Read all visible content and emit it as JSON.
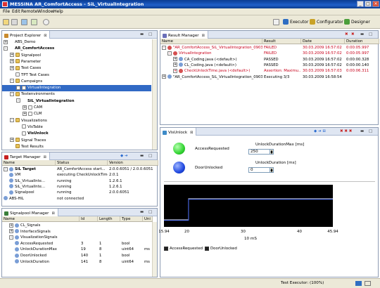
{
  "window": {
    "title": "MESSINA   AR_ComfortAccess - SiL_VirtualIntegration",
    "controls": [
      "_",
      "□",
      "×"
    ]
  },
  "menu": [
    "File",
    "Edit",
    "Remote",
    "Window",
    "Help"
  ],
  "perspectives": [
    {
      "label": "Executor",
      "icon": "executor-icon"
    },
    {
      "label": "Configurator",
      "icon": "configurator-icon"
    },
    {
      "label": "Designer",
      "icon": "designer-icon"
    }
  ],
  "project_explorer": {
    "title": "Project Explorer",
    "items": [
      {
        "label": "ABS_Demo",
        "indent": 0,
        "icon": "project",
        "exp": "+"
      },
      {
        "label": "AR_ComfortAccess",
        "indent": 0,
        "icon": "project",
        "exp": "-",
        "bold": true
      },
      {
        "label": "Signalpool",
        "indent": 1,
        "icon": "folder",
        "exp": "+"
      },
      {
        "label": "Parameter",
        "indent": 1,
        "icon": "folder",
        "exp": "+"
      },
      {
        "label": "Test Cases",
        "indent": 1,
        "icon": "folder",
        "exp": "+"
      },
      {
        "label": "TPT Test Cases",
        "indent": 1,
        "icon": "file",
        "exp": ""
      },
      {
        "label": "Campaigns",
        "indent": 1,
        "icon": "folder",
        "exp": "-"
      },
      {
        "label": "VirtualIntegration",
        "indent": 2,
        "icon": "file",
        "exp": "+",
        "selected": true
      },
      {
        "label": "Testenvironments",
        "indent": 1,
        "icon": "folder",
        "exp": "-"
      },
      {
        "label": "SiL_VirtualIntegration",
        "indent": 2,
        "icon": "project",
        "exp": "-",
        "bold": true
      },
      {
        "label": "CAM",
        "indent": 3,
        "icon": "file",
        "exp": "+"
      },
      {
        "label": "CLM",
        "indent": 3,
        "icon": "file",
        "exp": "+"
      },
      {
        "label": "Visualizations",
        "indent": 1,
        "icon": "folder",
        "exp": "-"
      },
      {
        "label": "VisTable",
        "indent": 2,
        "icon": "file",
        "exp": ""
      },
      {
        "label": "VisUnlock",
        "indent": 2,
        "icon": "file",
        "exp": "",
        "bold": true
      },
      {
        "label": "Signal Traces",
        "indent": 1,
        "icon": "folder",
        "exp": "+"
      },
      {
        "label": "Test Results",
        "indent": 1,
        "icon": "folder",
        "exp": ""
      }
    ]
  },
  "target_manager": {
    "title": "Target Manager",
    "columns": [
      "Name",
      "Status",
      "Version"
    ],
    "rows": [
      {
        "name": "SiL Target",
        "status": "AR_ComfortAccess start...",
        "version": "2.0.0.6051 / 2.0.0.6051",
        "indent": 0,
        "exp": "-",
        "bold": true
      },
      {
        "name": "VM",
        "status": "executing CheckUnlockTime",
        "version": "2.0.1",
        "indent": 1,
        "exp": ""
      },
      {
        "name": "SiL_VirtualInte...",
        "status": "running",
        "version": "1.2.6.1",
        "indent": 1,
        "exp": ""
      },
      {
        "name": "SiL_VirtualInte...",
        "status": "running",
        "version": "1.2.6.1",
        "indent": 1,
        "exp": ""
      },
      {
        "name": "Signalpool",
        "status": "running",
        "version": "2.0.0.6051",
        "indent": 1,
        "exp": ""
      },
      {
        "name": "ABS-HiL",
        "status": "not connected",
        "version": "",
        "indent": 0,
        "exp": ""
      }
    ]
  },
  "signalpool_manager": {
    "title": "Signalpool Manager",
    "columns": [
      "Name",
      "Id",
      "Length",
      "Type",
      "Uni"
    ],
    "rows": [
      {
        "name": "CL_Signals",
        "id": "",
        "length": "",
        "type": "",
        "unit": "",
        "indent": 1,
        "exp": "+"
      },
      {
        "name": "InterfaceSignals",
        "id": "",
        "length": "",
        "type": "",
        "unit": "",
        "indent": 1,
        "exp": "+"
      },
      {
        "name": "VisualizationSignals",
        "id": "",
        "length": "",
        "type": "",
        "unit": "",
        "indent": 1,
        "exp": "-"
      },
      {
        "name": "AccessRequested",
        "id": "3",
        "length": "1",
        "type": "bool",
        "unit": "",
        "indent": 2,
        "exp": ""
      },
      {
        "name": "UnlockDurationMax",
        "id": "19",
        "length": "8",
        "type": "uint64",
        "unit": "ms",
        "indent": 2,
        "exp": ""
      },
      {
        "name": "DoorUnlocked",
        "id": "140",
        "length": "1",
        "type": "bool",
        "unit": "",
        "indent": 2,
        "exp": ""
      },
      {
        "name": "UnlockDuration",
        "id": "141",
        "length": "8",
        "type": "uint64",
        "unit": "ms",
        "indent": 2,
        "exp": ""
      }
    ]
  },
  "result_manager": {
    "title": "Result Manager",
    "columns": [
      "Name",
      "Result",
      "Date",
      "Duration"
    ],
    "rows": [
      {
        "name": "\"AR_ComfortAccess_SiL_VirtualIntegration_09033...",
        "result": "FAILED",
        "date": "30.03.2009 16:57:02",
        "duration": "0:00:05.997",
        "indent": 0,
        "exp": "-",
        "red": true
      },
      {
        "name": "VirtualIntegration",
        "result": "FAILED",
        "date": "30.03.2009 16:57:02",
        "duration": "0:00:05.997",
        "indent": 1,
        "exp": "-",
        "red": true
      },
      {
        "name": "CA_Coding.java (<default>)",
        "result": "PASSED",
        "date": "30.03.2009 16:57:02",
        "duration": "0:00:00.328",
        "indent": 2,
        "exp": "+",
        "red": false
      },
      {
        "name": "CL_Coding.java (<default>)",
        "result": "PASSED",
        "date": "30.03.2009 16:57:02",
        "duration": "0:00:00.140",
        "indent": 2,
        "exp": "+",
        "red": false
      },
      {
        "name": "CheckUnlockTime.java (<default>)",
        "result": "Assertion: Maximu...",
        "date": "30.03.2009 16:57:03",
        "duration": "0:00:06.311",
        "indent": 2,
        "exp": "+",
        "red": true
      },
      {
        "name": "\"AR_ComfortAccess_SiL_VirtualIntegration_09033...",
        "result": "Executing 3/3",
        "date": "30.03.2009 16:58:54",
        "duration": "",
        "indent": 0,
        "exp": "+",
        "red": false
      }
    ]
  },
  "visunlock": {
    "title": "VisUnlock",
    "indicators": [
      {
        "label": "AccessRequested",
        "color": "#32d432"
      },
      {
        "label": "DoorUnlocked",
        "color": "#2048e0"
      }
    ],
    "max_label": "UnlockDurationMax [ms]",
    "max_value": "250",
    "dur_label": "UnlockDuration [ms]",
    "dur_value": "0"
  },
  "chart_data": {
    "type": "line",
    "xlim": [
      15.94,
      45.94
    ],
    "x_ticks": [
      "15.94",
      "20",
      "30",
      "40",
      "45.94"
    ],
    "xlabel": "10 mS",
    "series": [
      {
        "name": "AccessRequested",
        "color": "#ffffff",
        "x": [
          15.94,
          20.3,
          20.3,
          45.94
        ],
        "y": [
          0,
          0,
          1,
          1
        ]
      },
      {
        "name": "DoorUnlocked",
        "color": "#2a4dd8",
        "x": [
          15.94,
          20.3,
          20.3,
          45.94
        ],
        "y": [
          0,
          0,
          1,
          1
        ]
      }
    ]
  },
  "status": {
    "text": "Test Executor: (100%)"
  }
}
